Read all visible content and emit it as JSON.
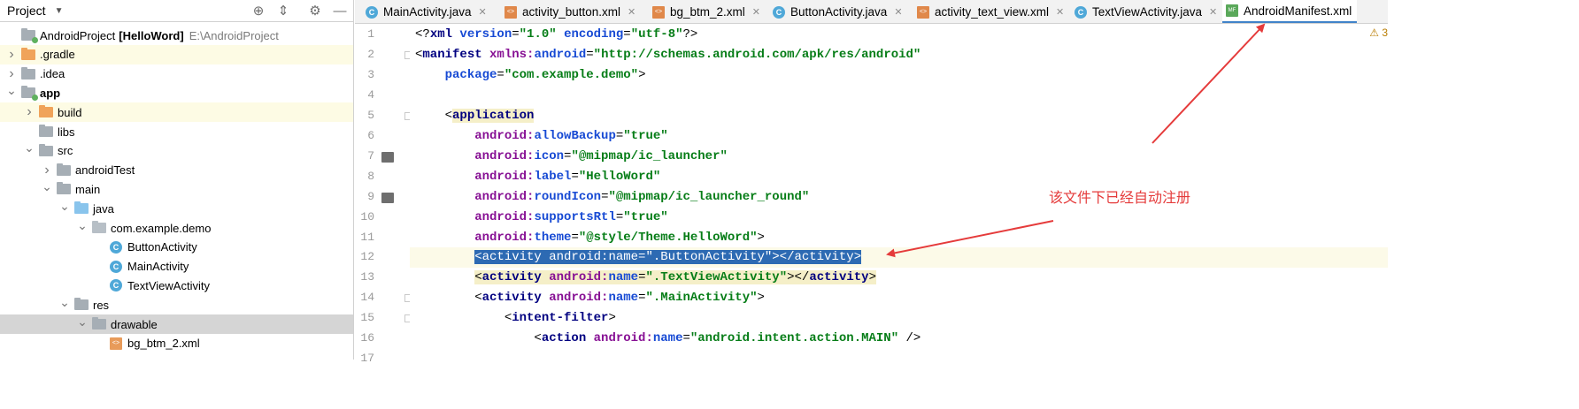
{
  "project_panel": {
    "title": "Project",
    "tree": [
      {
        "label": "AndroidProject",
        "bold_suffix": "[HelloWord]",
        "path": "E:\\AndroidProject",
        "depth": 0,
        "icon": "module",
        "twisty": "none"
      },
      {
        "label": ".gradle",
        "depth": 0,
        "icon": "folder-orange",
        "twisty": "closed",
        "highlight": "yellow"
      },
      {
        "label": ".idea",
        "depth": 0,
        "icon": "folder-grey",
        "twisty": "closed"
      },
      {
        "label": "app",
        "depth": 0,
        "icon": "module",
        "twisty": "open",
        "bold": true
      },
      {
        "label": "build",
        "depth": 1,
        "icon": "folder-orange",
        "twisty": "closed",
        "highlight": "yellow"
      },
      {
        "label": "libs",
        "depth": 1,
        "icon": "folder-grey",
        "twisty": "none"
      },
      {
        "label": "src",
        "depth": 1,
        "icon": "folder-grey",
        "twisty": "open"
      },
      {
        "label": "androidTest",
        "depth": 2,
        "icon": "folder-grey",
        "twisty": "closed"
      },
      {
        "label": "main",
        "depth": 2,
        "icon": "folder-grey",
        "twisty": "open"
      },
      {
        "label": "java",
        "depth": 3,
        "icon": "folder-blue",
        "twisty": "open"
      },
      {
        "label": "com.example.demo",
        "depth": 4,
        "icon": "package",
        "twisty": "open"
      },
      {
        "label": "ButtonActivity",
        "depth": 5,
        "icon": "class",
        "twisty": "none"
      },
      {
        "label": "MainActivity",
        "depth": 5,
        "icon": "class",
        "twisty": "none"
      },
      {
        "label": "TextViewActivity",
        "depth": 5,
        "icon": "class",
        "twisty": "none"
      },
      {
        "label": "res",
        "depth": 3,
        "icon": "folder-res",
        "twisty": "open"
      },
      {
        "label": "drawable",
        "depth": 4,
        "icon": "folder-grey",
        "twisty": "open",
        "highlight": "selected"
      },
      {
        "label": "bg_btm_2.xml",
        "depth": 5,
        "icon": "xml",
        "twisty": "none"
      }
    ]
  },
  "tabs": [
    {
      "label": "MainActivity.java",
      "icon": "class",
      "active": false
    },
    {
      "label": "activity_button.xml",
      "icon": "xml",
      "active": false
    },
    {
      "label": "bg_btm_2.xml",
      "icon": "xml",
      "active": false
    },
    {
      "label": "ButtonActivity.java",
      "icon": "class",
      "active": false
    },
    {
      "label": "activity_text_view.xml",
      "icon": "xml",
      "active": false
    },
    {
      "label": "TextViewActivity.java",
      "icon": "class",
      "active": false
    },
    {
      "label": "AndroidManifest.xml",
      "icon": "manifest",
      "active": true
    }
  ],
  "editor": {
    "warning_count": "3",
    "current_line": 12,
    "lines": [
      {
        "n": "1",
        "tokens": [
          [
            "pi",
            "<?"
          ],
          [
            "tag",
            "xml "
          ],
          [
            "attr",
            "version"
          ],
          [
            "pl",
            "="
          ],
          [
            "val",
            "\"1.0\" "
          ],
          [
            "attr",
            "encoding"
          ],
          [
            "pl",
            "="
          ],
          [
            "val",
            "\"utf-8\""
          ],
          [
            "pi",
            "?>"
          ]
        ]
      },
      {
        "n": "2",
        "tokens": [
          [
            "pl",
            "<"
          ],
          [
            "tag",
            "manifest "
          ],
          [
            "ns",
            "xmlns:"
          ],
          [
            "attr",
            "android"
          ],
          [
            "pl",
            "="
          ],
          [
            "val",
            "\"http://schemas.android.com/apk/res/android\""
          ]
        ]
      },
      {
        "n": "3",
        "tokens": [
          [
            "pl",
            "    "
          ],
          [
            "attr",
            "package"
          ],
          [
            "pl",
            "="
          ],
          [
            "val",
            "\"com.example.demo\""
          ],
          [
            "pl",
            ">"
          ]
        ]
      },
      {
        "n": "4",
        "tokens": []
      },
      {
        "n": "5",
        "tokens": [
          [
            "pl",
            "    <"
          ],
          [
            "tag",
            "application"
          ]
        ],
        "tag_highlight": true
      },
      {
        "n": "6",
        "tokens": [
          [
            "pl",
            "        "
          ],
          [
            "ns",
            "android:"
          ],
          [
            "attr",
            "allowBackup"
          ],
          [
            "pl",
            "="
          ],
          [
            "val",
            "\"true\""
          ]
        ]
      },
      {
        "n": "7",
        "tokens": [
          [
            "pl",
            "        "
          ],
          [
            "ns",
            "android:"
          ],
          [
            "attr",
            "icon"
          ],
          [
            "pl",
            "="
          ],
          [
            "val",
            "\"@mipmap/ic_launcher\""
          ]
        ]
      },
      {
        "n": "8",
        "tokens": [
          [
            "pl",
            "        "
          ],
          [
            "ns",
            "android:"
          ],
          [
            "attr",
            "label"
          ],
          [
            "pl",
            "="
          ],
          [
            "val",
            "\"HelloWord\""
          ]
        ]
      },
      {
        "n": "9",
        "tokens": [
          [
            "pl",
            "        "
          ],
          [
            "ns",
            "android:"
          ],
          [
            "attr",
            "roundIcon"
          ],
          [
            "pl",
            "="
          ],
          [
            "val",
            "\"@mipmap/ic_launcher_round\""
          ]
        ]
      },
      {
        "n": "10",
        "tokens": [
          [
            "pl",
            "        "
          ],
          [
            "ns",
            "android:"
          ],
          [
            "attr",
            "supportsRtl"
          ],
          [
            "pl",
            "="
          ],
          [
            "val",
            "\"true\""
          ]
        ]
      },
      {
        "n": "11",
        "tokens": [
          [
            "pl",
            "        "
          ],
          [
            "ns",
            "android:"
          ],
          [
            "attr",
            "theme"
          ],
          [
            "pl",
            "="
          ],
          [
            "val",
            "\"@style/Theme.HelloWord\""
          ],
          [
            "pl",
            ">"
          ]
        ]
      },
      {
        "n": "12",
        "tokens": [
          [
            "pl",
            "        "
          ],
          [
            "sel",
            "<activity android:name=\".ButtonActivity\"></activity>"
          ]
        ]
      },
      {
        "n": "13",
        "tokens": [
          [
            "pl",
            "        "
          ],
          [
            "hl",
            "<"
          ],
          [
            "hltag",
            "activity "
          ],
          [
            "hlns",
            "android:"
          ],
          [
            "hlattr",
            "name"
          ],
          [
            "hl",
            "="
          ],
          [
            "hlval",
            "\".TextViewActivity\""
          ],
          [
            "hl",
            "></"
          ],
          [
            "hltag",
            "activity"
          ],
          [
            "hl",
            ">"
          ]
        ]
      },
      {
        "n": "14",
        "tokens": [
          [
            "pl",
            "        <"
          ],
          [
            "tag",
            "activity "
          ],
          [
            "ns",
            "android:"
          ],
          [
            "attr",
            "name"
          ],
          [
            "pl",
            "="
          ],
          [
            "val",
            "\".MainActivity\""
          ],
          [
            "pl",
            ">"
          ]
        ]
      },
      {
        "n": "15",
        "tokens": [
          [
            "pl",
            "            <"
          ],
          [
            "tag",
            "intent-filter"
          ],
          [
            "pl",
            ">"
          ]
        ]
      },
      {
        "n": "16",
        "tokens": [
          [
            "pl",
            "                <"
          ],
          [
            "tag",
            "action "
          ],
          [
            "ns",
            "android:"
          ],
          [
            "attr",
            "name"
          ],
          [
            "pl",
            "="
          ],
          [
            "val",
            "\"android.intent.action.MAIN\""
          ],
          [
            "pl",
            " />"
          ]
        ]
      },
      {
        "n": "17",
        "tokens": []
      }
    ]
  },
  "annotation": {
    "text": "该文件下已经自动注册"
  },
  "colors": {
    "arrow": "#e53b3b",
    "selection": "#2d6ab3",
    "tab_underline": "#4083c9"
  }
}
